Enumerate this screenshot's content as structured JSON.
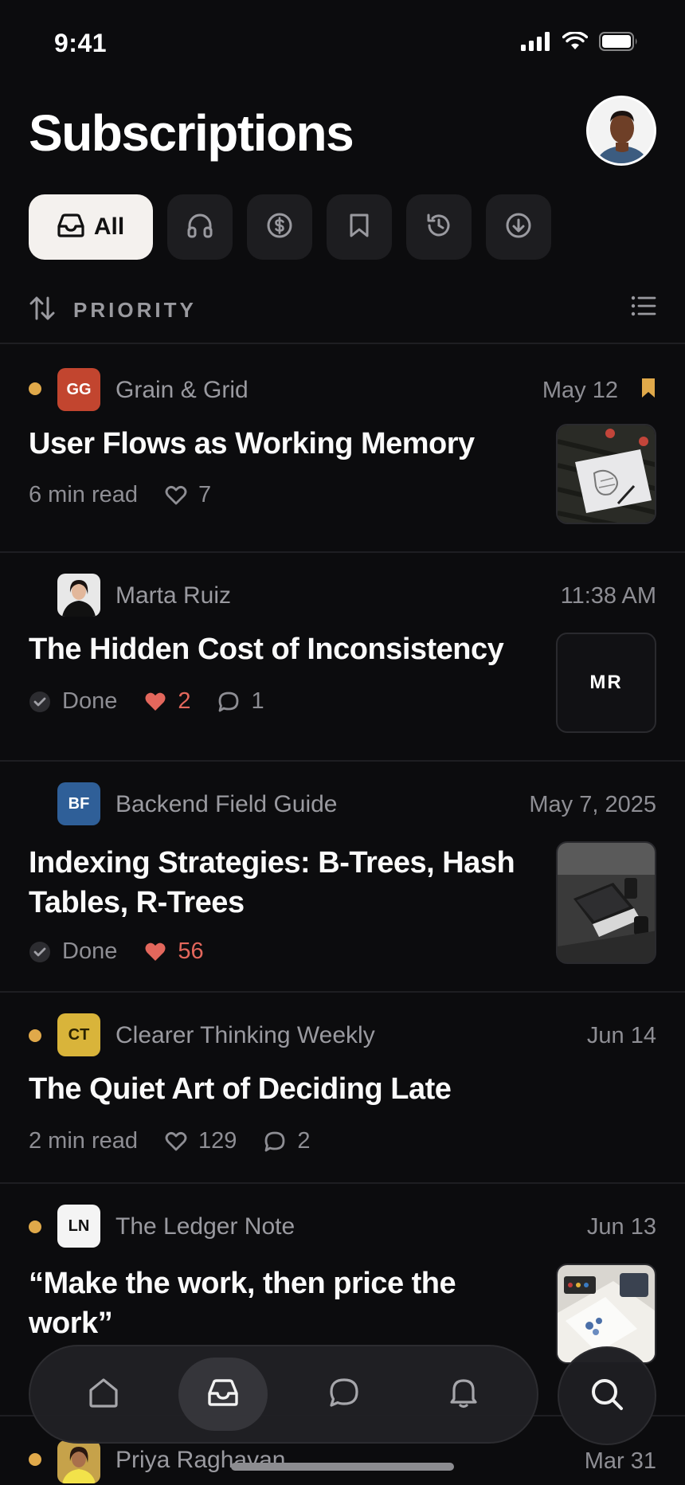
{
  "status_bar": {
    "time": "9:41"
  },
  "header": {
    "title": "Subscriptions"
  },
  "filters": {
    "all_label": "All"
  },
  "sort": {
    "label": "PRIORITY"
  },
  "items": [
    {
      "publication": "Grain & Grid",
      "logo_text": "GG",
      "logo_color": "#c2452f",
      "date": "May 12",
      "unread": true,
      "bookmarked": true,
      "title": "User Flows as Working Memory",
      "read_time": "6 min read",
      "likes": "7"
    },
    {
      "publication": "Marta Ruiz",
      "date": "11:38 AM",
      "unread": false,
      "title": "The Hidden Cost of Inconsistency",
      "status": "Done",
      "likes": "2",
      "comments": "1",
      "thumb_text": "MR"
    },
    {
      "publication": "Backend Field Guide",
      "logo_text": "BF",
      "logo_color": "#2f5f98",
      "date": "May 7, 2025",
      "unread": false,
      "title_line1": "Indexing Strategies: B-Trees, Hash",
      "title_line2": "Tables, R-Trees",
      "status": "Done",
      "likes": "56"
    },
    {
      "publication": "Clearer Thinking Weekly",
      "logo_text": "CT",
      "logo_color": "#d9b43a",
      "date": "Jun 14",
      "unread": true,
      "title": "The Quiet Art of Deciding Late",
      "read_time": "2 min read",
      "likes": "129",
      "comments": "2"
    },
    {
      "publication": "The Ledger Note",
      "logo_text": "LN",
      "logo_color": "#f4f4f4",
      "date": "Jun 13",
      "unread": true,
      "title_line1": "“Make the work, then price the",
      "title_line2": "work”"
    },
    {
      "publication": "Priya Raghavan",
      "date": "Mar 31",
      "unread": true
    }
  ],
  "colors": {
    "accent_dot": "#e0a94a",
    "like_red": "#e3675c",
    "background": "#0c0c0e"
  },
  "tab_bar": {
    "icons": [
      "home-icon",
      "inbox-icon",
      "chat-icon",
      "bell-icon"
    ],
    "active": "inbox-icon"
  }
}
